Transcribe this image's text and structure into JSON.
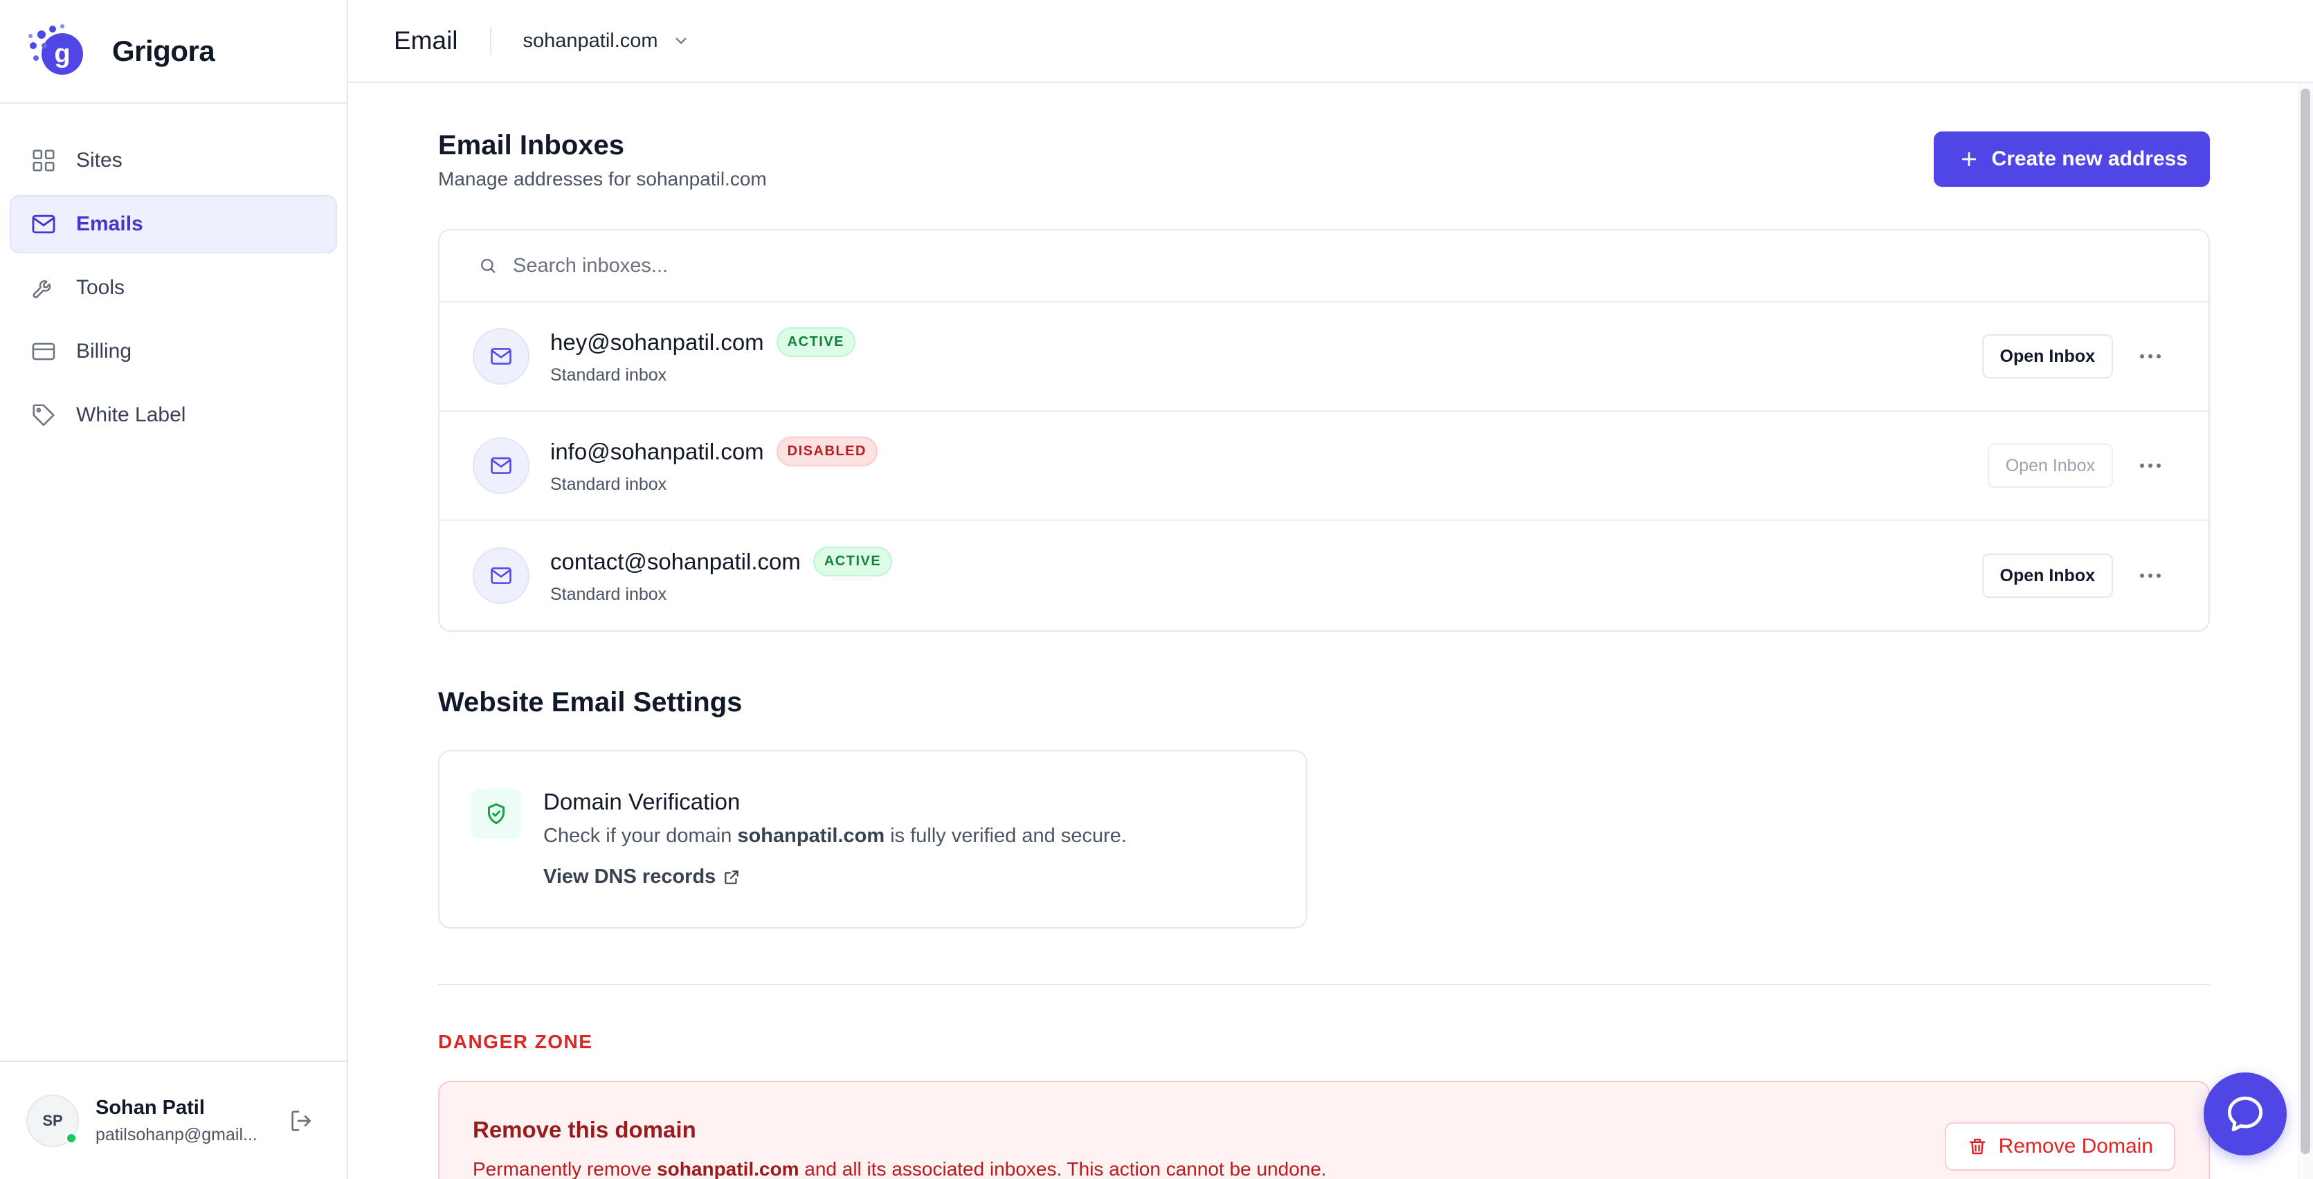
{
  "brand": {
    "name": "Grigora",
    "accent": "#4f46e5"
  },
  "sidebar": {
    "items": [
      {
        "label": "Sites",
        "icon": "grid-icon"
      },
      {
        "label": "Emails",
        "icon": "mail-icon",
        "active": true
      },
      {
        "label": "Tools",
        "icon": "wrench-icon"
      },
      {
        "label": "Billing",
        "icon": "credit-card-icon"
      },
      {
        "label": "White Label",
        "icon": "tag-icon"
      }
    ]
  },
  "user": {
    "initials": "SP",
    "name": "Sohan Patil",
    "email": "patilsohanp@gmail..."
  },
  "header": {
    "title": "Email",
    "domain": "sohanpatil.com"
  },
  "inboxes": {
    "title": "Email Inboxes",
    "subtitle": "Manage addresses for sohanpatil.com",
    "create_label": "Create new address",
    "search_placeholder": "Search inboxes...",
    "open_label": "Open Inbox",
    "items": [
      {
        "address": "hey@sohanpatil.com",
        "status": "ACTIVE",
        "type": "Standard inbox"
      },
      {
        "address": "info@sohanpatil.com",
        "status": "DISABLED",
        "type": "Standard inbox"
      },
      {
        "address": "contact@sohanpatil.com",
        "status": "ACTIVE",
        "type": "Standard inbox"
      }
    ]
  },
  "settings": {
    "title": "Website Email Settings",
    "verification": {
      "title": "Domain Verification",
      "desc_before": "Check if your domain ",
      "desc_domain": "sohanpatil.com",
      "desc_after": " is fully verified and secure.",
      "link": "View DNS records"
    }
  },
  "danger": {
    "title": "DANGER ZONE",
    "card_title": "Remove this domain",
    "desc_before": "Permanently remove ",
    "desc_domain": "sohanpatil.com",
    "desc_after": " and all its associated inboxes. This action cannot be undone.",
    "button": "Remove Domain"
  },
  "colors": {
    "active_badge": "#15803d",
    "disabled_badge": "#b91c1c",
    "danger": "#dc2626"
  }
}
